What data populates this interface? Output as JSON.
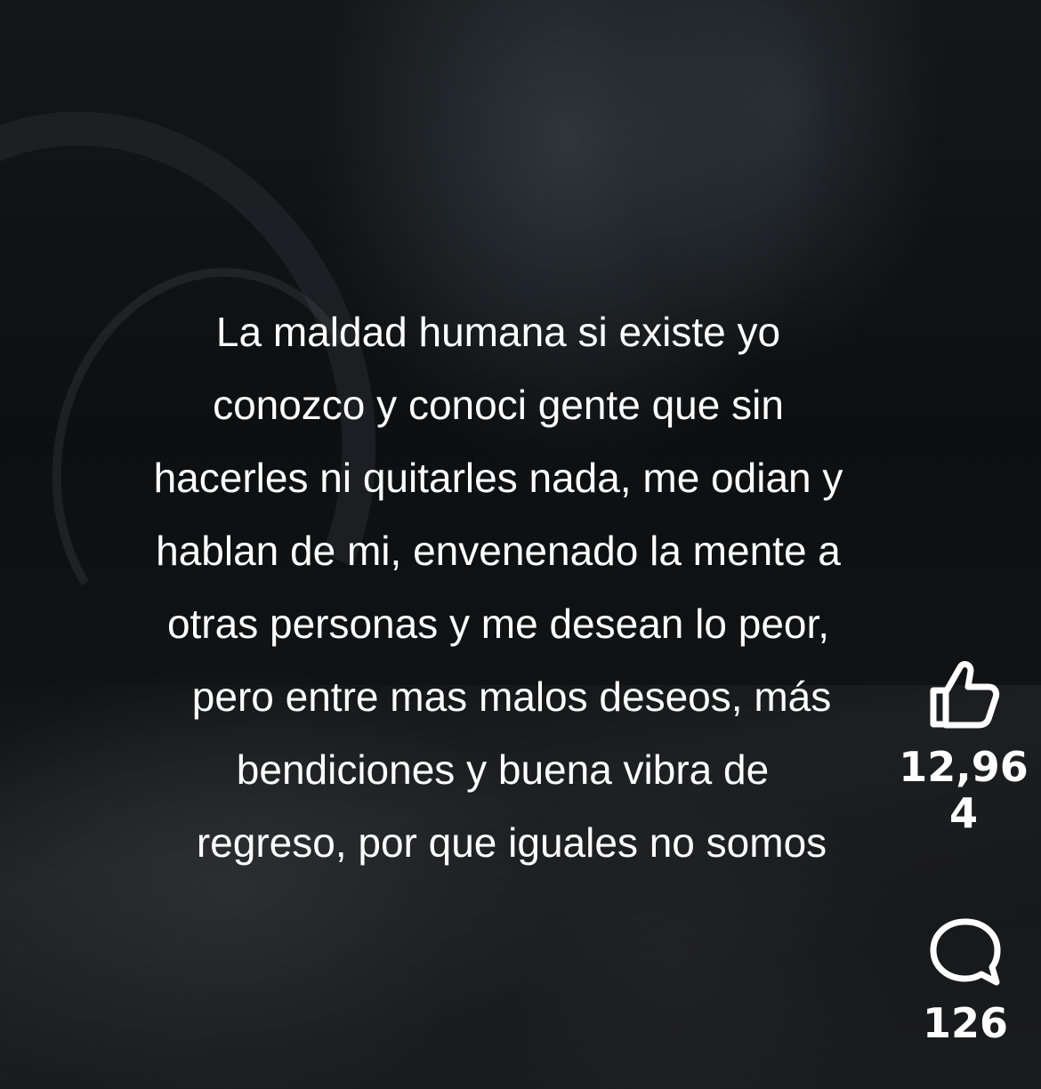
{
  "caption": {
    "lines": [
      "La maldad humana si existe yo",
      "conozco y conoci gente que sin",
      "hacerles ni quitarles nada, me odian y",
      "hablan de mi, envenenado la mente a",
      "otras personas y me desean lo peor,",
      "pero entre mas malos deseos, más",
      "bendiciones y buena vibra de",
      "regreso, por que iguales no somos"
    ]
  },
  "actions": {
    "like": {
      "icon": "thumbs-up-icon",
      "count": "12,964"
    },
    "comment": {
      "icon": "speech-bubble-icon",
      "count": "126"
    }
  },
  "colors": {
    "text": "#ffffff",
    "background": "#0b0c0e"
  }
}
